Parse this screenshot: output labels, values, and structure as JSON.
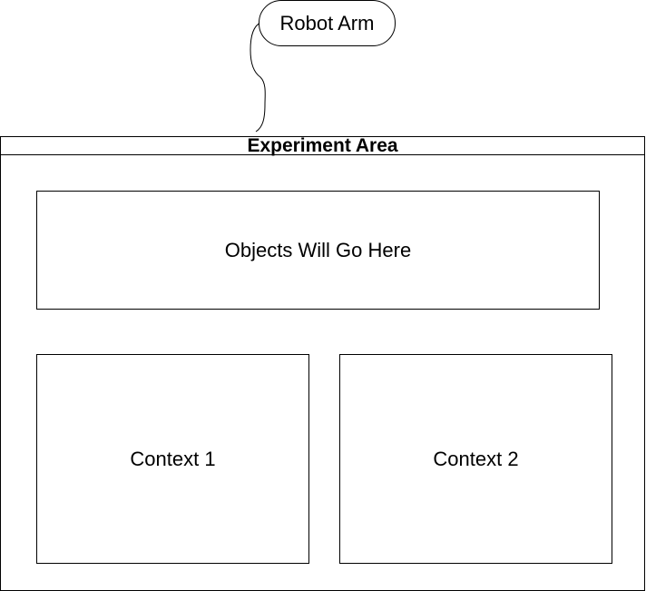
{
  "diagram": {
    "robot_arm": {
      "label": "Robot Arm"
    },
    "experiment_area": {
      "title": "Experiment Area",
      "objects_box": {
        "label": "Objects Will Go Here"
      },
      "contexts": [
        {
          "label": "Context 1"
        },
        {
          "label": "Context 2"
        }
      ]
    }
  },
  "colors": {
    "stroke": "#000000",
    "fill": "#ffffff",
    "text": "#000000"
  }
}
